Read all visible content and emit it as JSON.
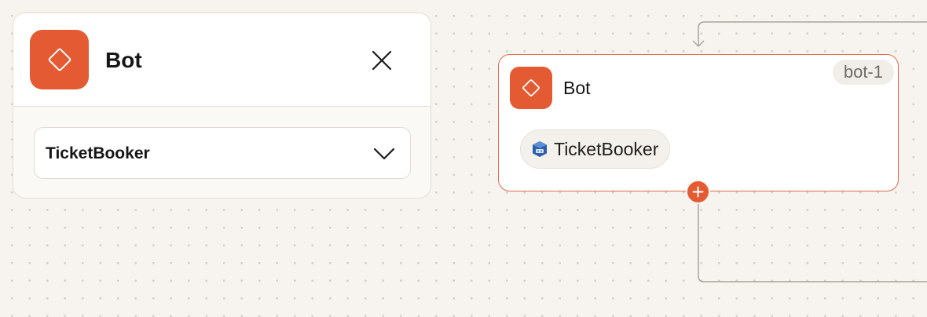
{
  "panel": {
    "icon": "diamond-icon",
    "title": "Bot",
    "close_icon": "close-icon",
    "select": {
      "value": "TicketBooker",
      "chevron_icon": "chevron-down-icon"
    }
  },
  "node": {
    "icon": "diamond-icon",
    "title": "Bot",
    "id_badge": "bot-1",
    "chip": {
      "icon": "lex-bot-icon",
      "label": "TicketBooker"
    },
    "add_icon": "plus-icon"
  },
  "colors": {
    "accent": "#e35a33",
    "node_border": "#e06b4e",
    "canvas": "#f7f4ef",
    "connector": "#a7a39d"
  }
}
